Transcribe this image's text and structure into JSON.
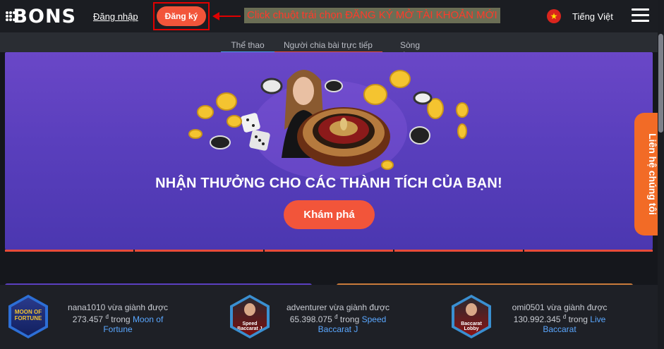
{
  "header": {
    "logo_text": "BONS",
    "login_label": "Đăng nhập",
    "register_label": "Đăng ký",
    "annotation": "Click chuột trái chọn ĐĂNG KÝ MỞ TÀI KHOẢN MỚI",
    "language": "Tiếng Việt"
  },
  "tabs": [
    {
      "label": "Thể thao",
      "color": "#4a9cf0"
    },
    {
      "label": "Người chia bài trực tiếp",
      "color": "#e84b3a"
    },
    {
      "label": "Sòng bạc",
      "color": "#3fb36a"
    }
  ],
  "banner": {
    "title": "NHẬN THƯỞNG CHO CÁC THÀNH TÍCH CỦA BẠN!",
    "button_label": "Khám phá"
  },
  "contact_label": "Liên hệ chúng tôi",
  "winners": [
    {
      "user_line": "nana1010 vừa giành được",
      "amount": "273.457",
      "currency": "đ",
      "in_word": "trong",
      "game": "Moon of Fortune",
      "thumb_text": "MOON OF FORTUNE"
    },
    {
      "user_line": "adventurer vừa giành được",
      "amount": "65.398.075",
      "currency": "đ",
      "in_word": "trong",
      "game": "Speed Baccarat J",
      "thumb_text": "Speed Baccarat J"
    },
    {
      "user_line": "omi0501 vừa giành được",
      "amount": "130.992.345",
      "currency": "đ",
      "in_word": "trong",
      "game": "Live Baccarat",
      "thumb_text": "Baccarat Lobby"
    }
  ],
  "colors": {
    "accent": "#f2553a",
    "banner": "#5a3fbd",
    "contact": "#f26b26"
  },
  "icons": [
    "vietnam-flag-icon",
    "hamburger-menu-icon",
    "arrow-left-icon"
  ]
}
